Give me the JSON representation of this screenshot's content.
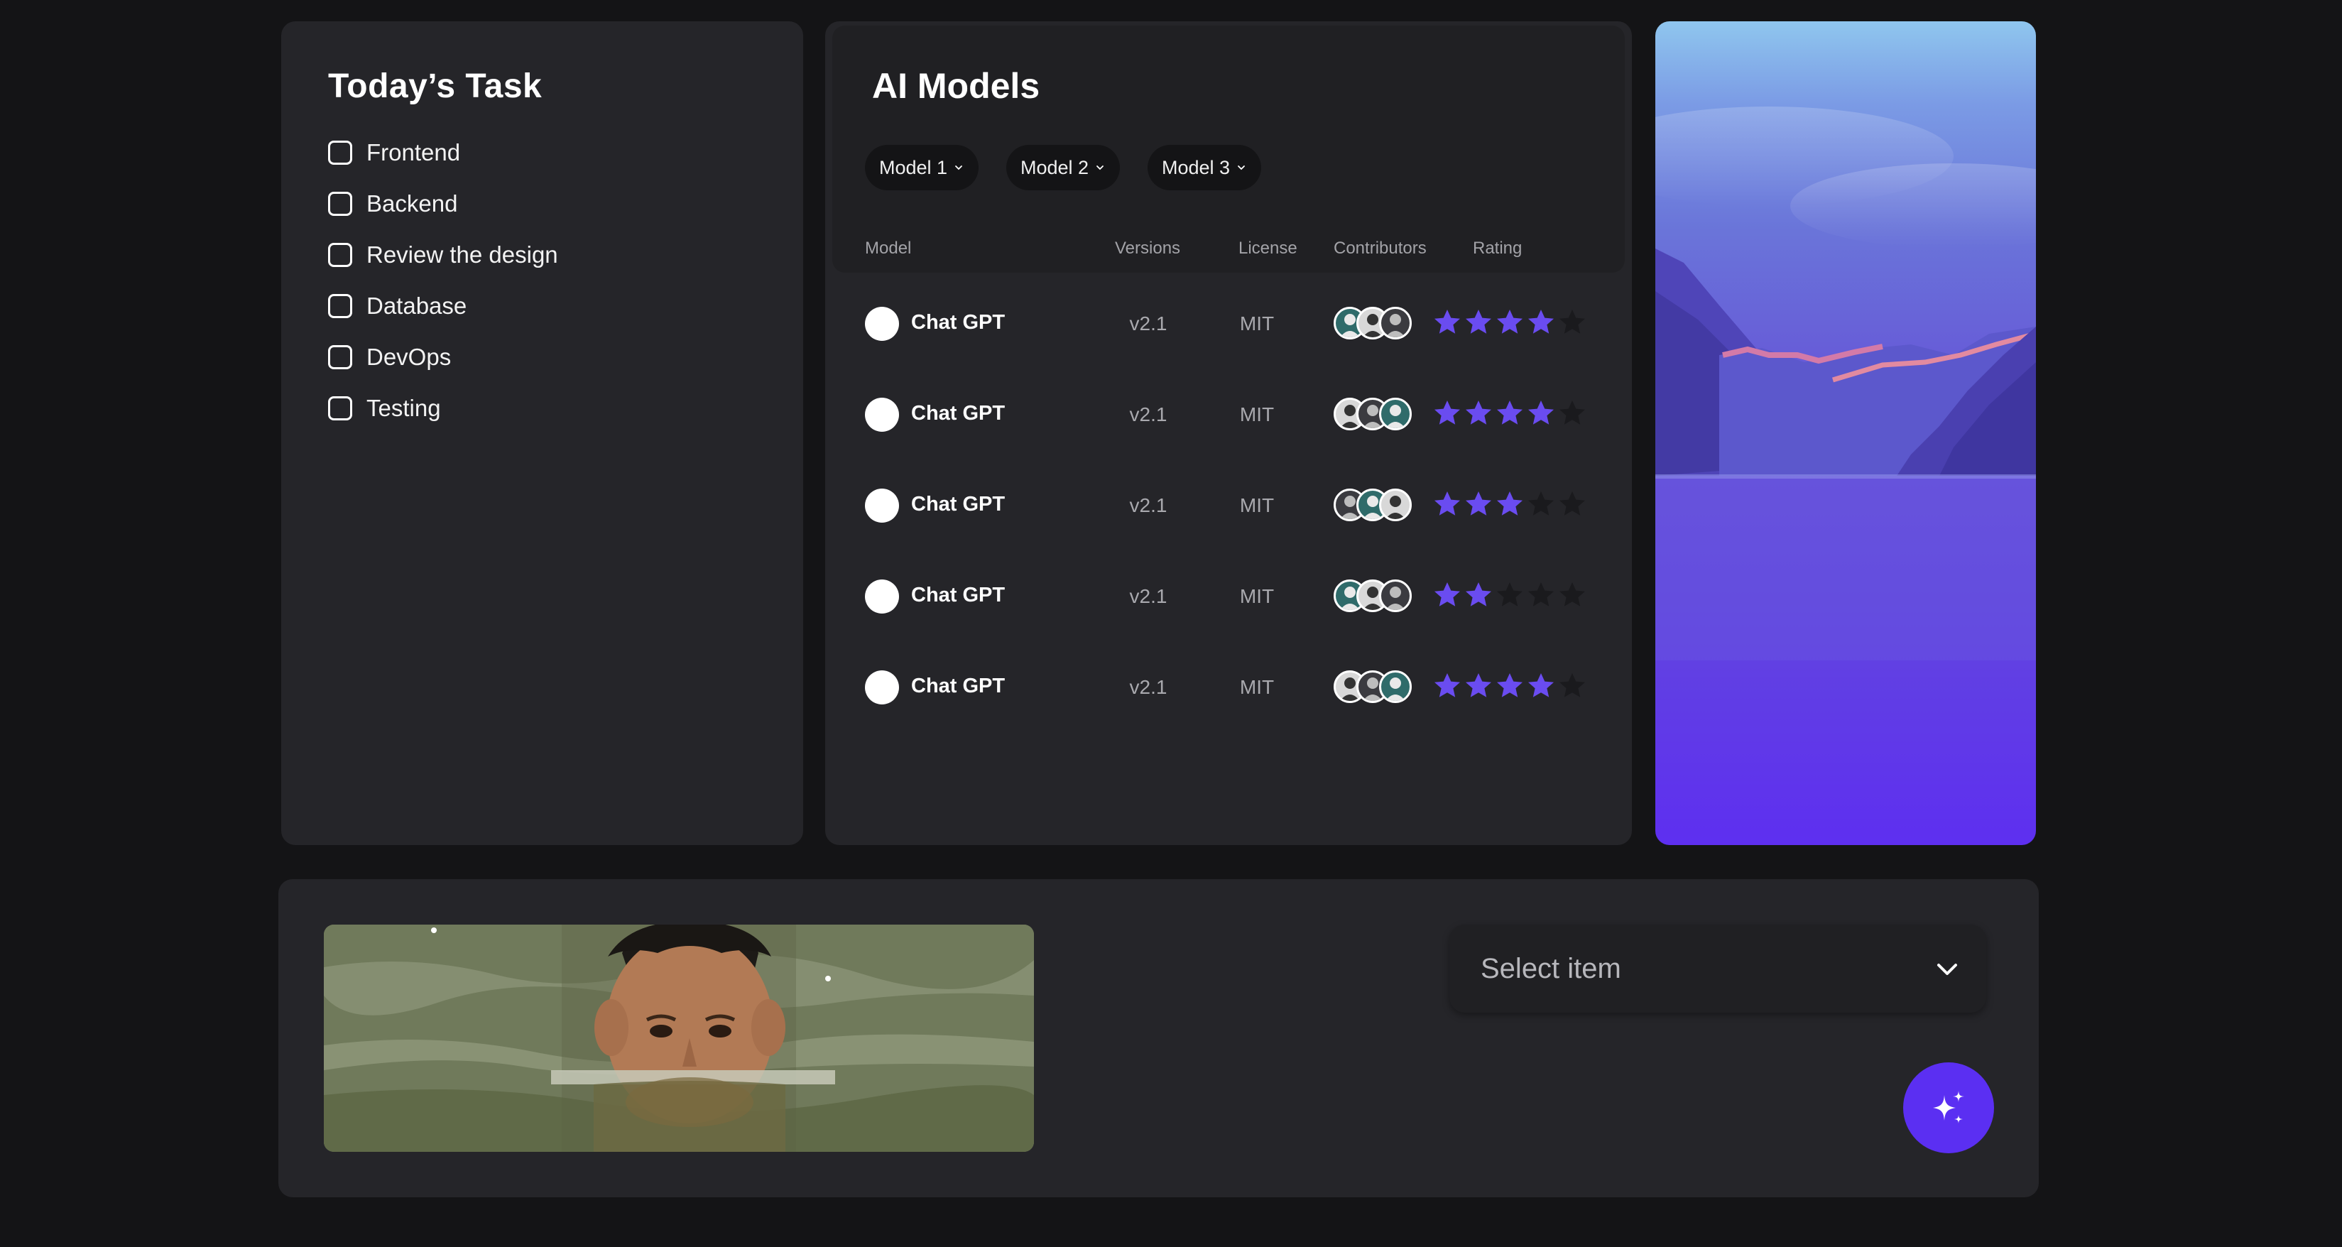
{
  "tasks": {
    "title": "Today’s Task",
    "items": [
      {
        "label": "Frontend",
        "checked": false
      },
      {
        "label": "Backend",
        "checked": false
      },
      {
        "label": "Review the design",
        "checked": false
      },
      {
        "label": "Database",
        "checked": false
      },
      {
        "label": "DevOps",
        "checked": false
      },
      {
        "label": "Testing",
        "checked": false
      }
    ]
  },
  "models": {
    "title": "AI Models",
    "filters": [
      "Model 1",
      "Model 2",
      "Model 3"
    ],
    "columns": {
      "model": "Model",
      "versions": "Versions",
      "license": "License",
      "contributors": "Contributors",
      "rating": "Rating"
    },
    "rows": [
      {
        "name": "Chat GPT",
        "version": "v2.1",
        "license": "MIT",
        "rating": 4
      },
      {
        "name": "Chat GPT",
        "version": "v2.1",
        "license": "MIT",
        "rating": 4
      },
      {
        "name": "Chat GPT",
        "version": "v2.1",
        "license": "MIT",
        "rating": 3
      },
      {
        "name": "Chat GPT",
        "version": "v2.1",
        "license": "MIT",
        "rating": 2
      },
      {
        "name": "Chat GPT",
        "version": "v2.1",
        "license": "MIT",
        "rating": 4
      }
    ],
    "max_rating": 5
  },
  "select": {
    "placeholder": "Select item"
  },
  "colors": {
    "accent": "#5b2ff2",
    "star_on": "#6a4cf0",
    "star_off": "#1a1a1d"
  },
  "icons": {
    "select_chevron": "chevron-down-icon",
    "magic": "sparkles-icon"
  }
}
